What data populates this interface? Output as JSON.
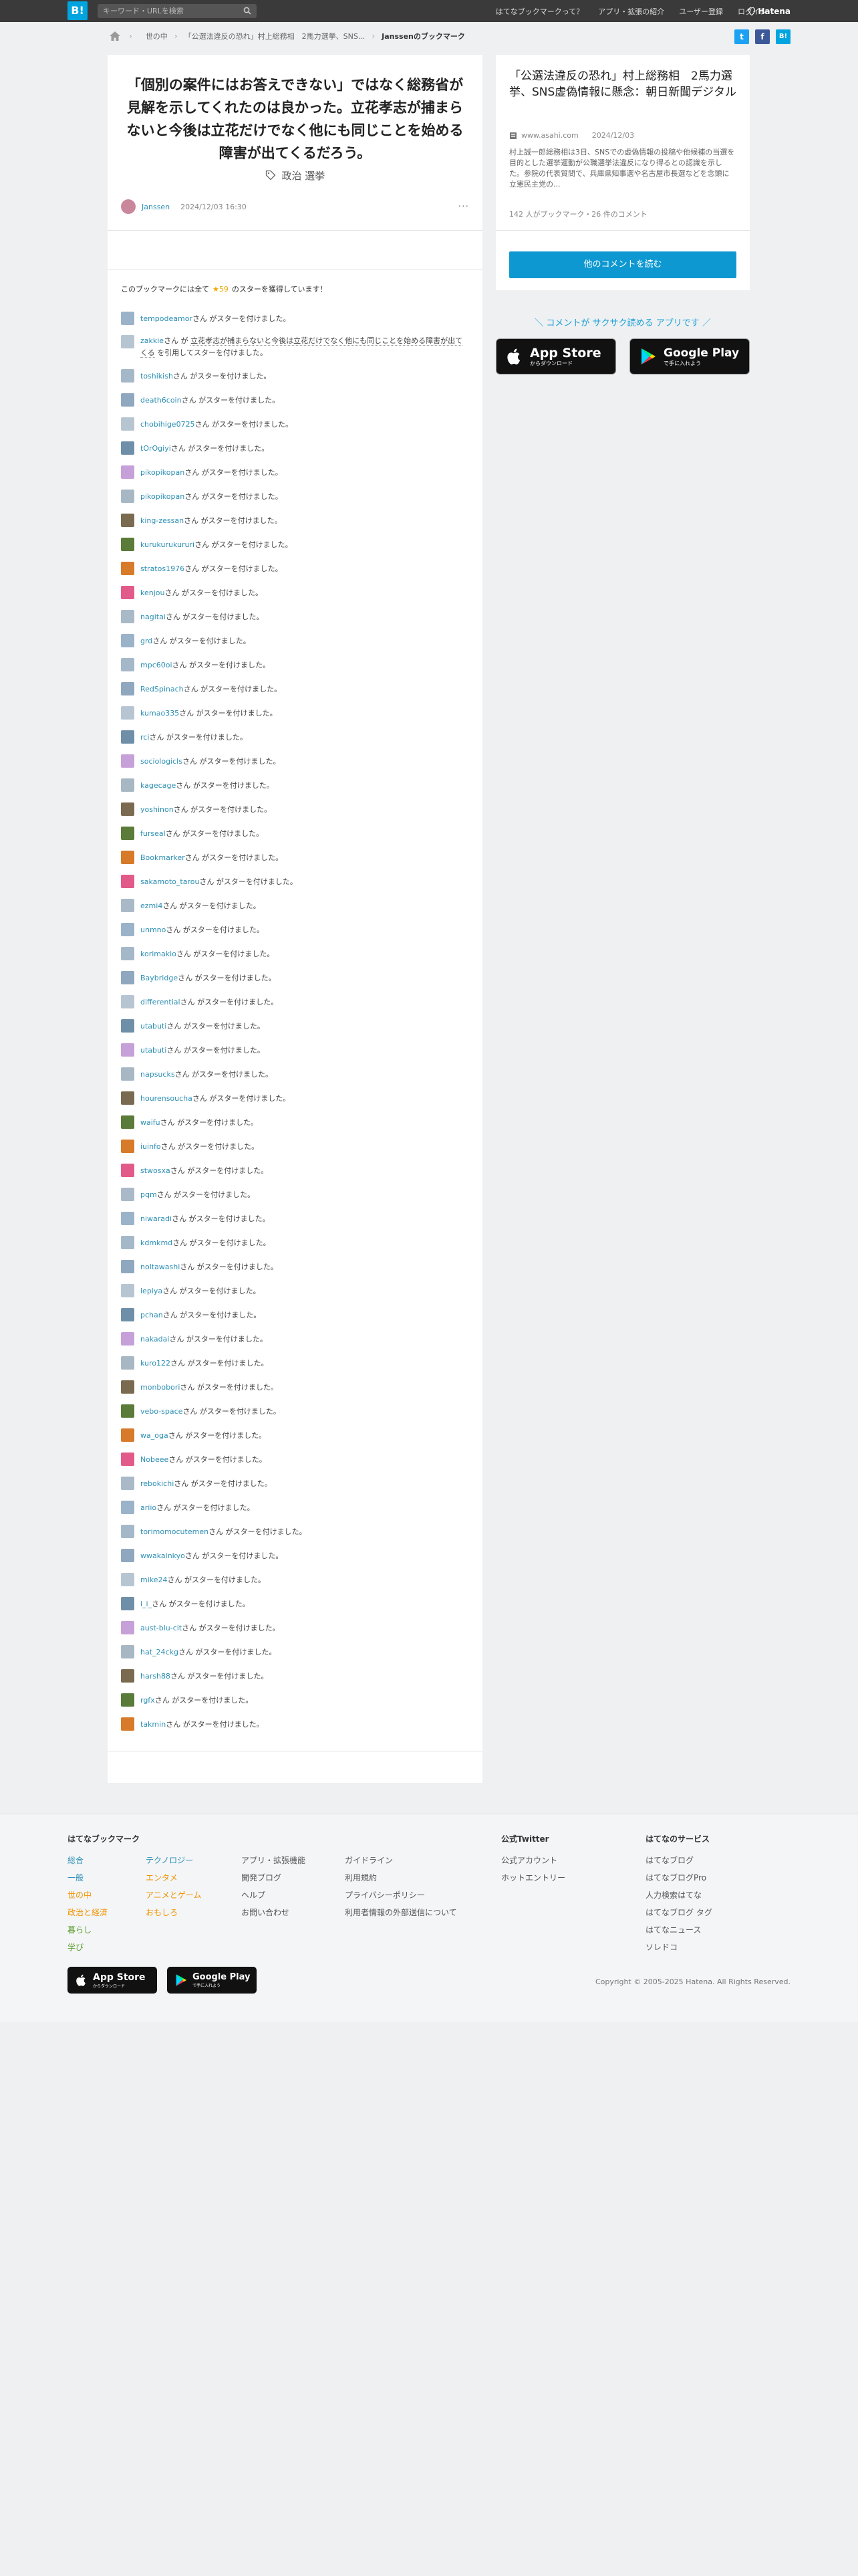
{
  "header": {
    "logo": "B!",
    "search_placeholder": "キーワード・URLを検索",
    "nav": [
      "はてなブックマークって？",
      "アプリ・拡張の紹介",
      "ユーザー登録",
      "ログイン"
    ],
    "brand": "Hatena"
  },
  "breadcrumb": {
    "category": "世の中",
    "entry": "「公選法違反の恐れ」村上総務相　2馬力選挙、SNS...",
    "current": "Janssenのブックマーク"
  },
  "bookmark": {
    "comment": "「個別の案件にはお答えできない」ではなく総務省が見解を示してくれたのは良かった。立花孝志が捕まらないと今後は立花だけでなく他にも同じことを始める障害が出てくるだろう。",
    "tags_label": "政治 選挙",
    "user": "Janssen",
    "date": "2024/12/03 16:30",
    "more": "···"
  },
  "stars": {
    "prefix": "このブックマークには全て",
    "count": "★59",
    "suffix": "のスターを獲得しています！",
    "verb": "さん がスターを付けました。",
    "quote_item": {
      "user": "zakkie",
      "pre": "さん が",
      "quoted": "立花孝志が捕まらないと今後は立花だけでなく他にも同じことを始める障害が出てくる",
      "post": "を引用してスターを付けました。"
    },
    "users": [
      "tempodeamor",
      "toshikish",
      "death6coin",
      "chobihige0725",
      "tOrOgiyi",
      "pikopikopan",
      "pikopikopan",
      "king-zessan",
      "kurukurukururi",
      "stratos1976",
      "kenjou",
      "nagitai",
      "grd",
      "mpc60oi",
      "RedSpinach",
      "kumao335",
      "rci",
      "sociologicls",
      "kagecage",
      "yoshinon",
      "furseal",
      "Bookmarker",
      "sakamoto_tarou",
      "ezmi4",
      "unmno",
      "korimakio",
      "Baybridge",
      "differential",
      "utabuti",
      "utabuti",
      "napsucks",
      "hourensoucha",
      "waifu",
      "iuinfo",
      "stwosxa",
      "pqm",
      "niwaradi",
      "kdmkmd",
      "noltawashi",
      "lepiya",
      "pchan",
      "nakadai",
      "kuro122",
      "monbobori",
      "vebo-space",
      "wa_oga",
      "Nobeee",
      "rebokichi",
      "ariio",
      "torimomocutemen",
      "wwakainkyo",
      "mike24",
      "i_i_",
      "aust-blu-cit",
      "hat_24ckg",
      "harsh88",
      "rgfx",
      "takmin"
    ]
  },
  "side": {
    "title": "「公選法違反の恐れ」村上総務相　2馬力選挙、SNS虚偽情報に懸念：朝日新聞デジタル",
    "domain": "www.asahi.com",
    "date": "2024/12/03",
    "description": "村上誠一郎総務相は3日、SNSでの虚偽情報の投稿や他候補の当選を目的とした選挙運動が公職選挙法違反になり得るとの認識を示した。参院の代表質問で、兵庫県知事選や名古屋市長選などを念頭に立憲民主党の...",
    "counts": "142 人がブックマーク・26 件のコメント",
    "button": "他のコメントを読む",
    "app_lead": "＼ コメントが サクサク読める アプリです ／",
    "appstore_big": "App Store",
    "appstore_small": "からダウンロード",
    "googleplay_big": "Google Play",
    "googleplay_small": "で手に入れよう"
  },
  "footer": {
    "bookmark_title": "はてなブックマーク",
    "col1": [
      "総合",
      "一般",
      "世の中",
      "政治と経済",
      "暮らし",
      "学び"
    ],
    "col2": [
      "テクノロジー",
      "エンタメ",
      "アニメとゲーム",
      "おもしろ"
    ],
    "col3": [
      "アプリ・拡張機能",
      "開発ブログ",
      "ヘルプ",
      "お問い合わせ"
    ],
    "col4": [
      "ガイドライン",
      "利用規約",
      "プライバシーポリシー",
      "利用者情報の外部送信について"
    ],
    "twitter_title": "公式Twitter",
    "twitter": [
      "公式アカウント",
      "ホットエントリー"
    ],
    "services_title": "はてなのサービス",
    "services": [
      "はてなブログ",
      "はてなブログPro",
      "人力検索はてな",
      "はてなブログ タグ",
      "はてなニュース",
      "ソレドコ"
    ],
    "appstore_big": "App Store",
    "appstore_small": "からダウンロード",
    "googleplay_big": "Google Play",
    "googleplay_small": "で手に入れよう",
    "copyright": "Copyright © 2005-2025 Hatena. All Rights Reserved."
  },
  "colors": {
    "accent": "#00a4de",
    "star": "#f0a800",
    "link": "#2c8fb4",
    "twitter": "#1da1f2",
    "facebook": "#3b5998"
  }
}
